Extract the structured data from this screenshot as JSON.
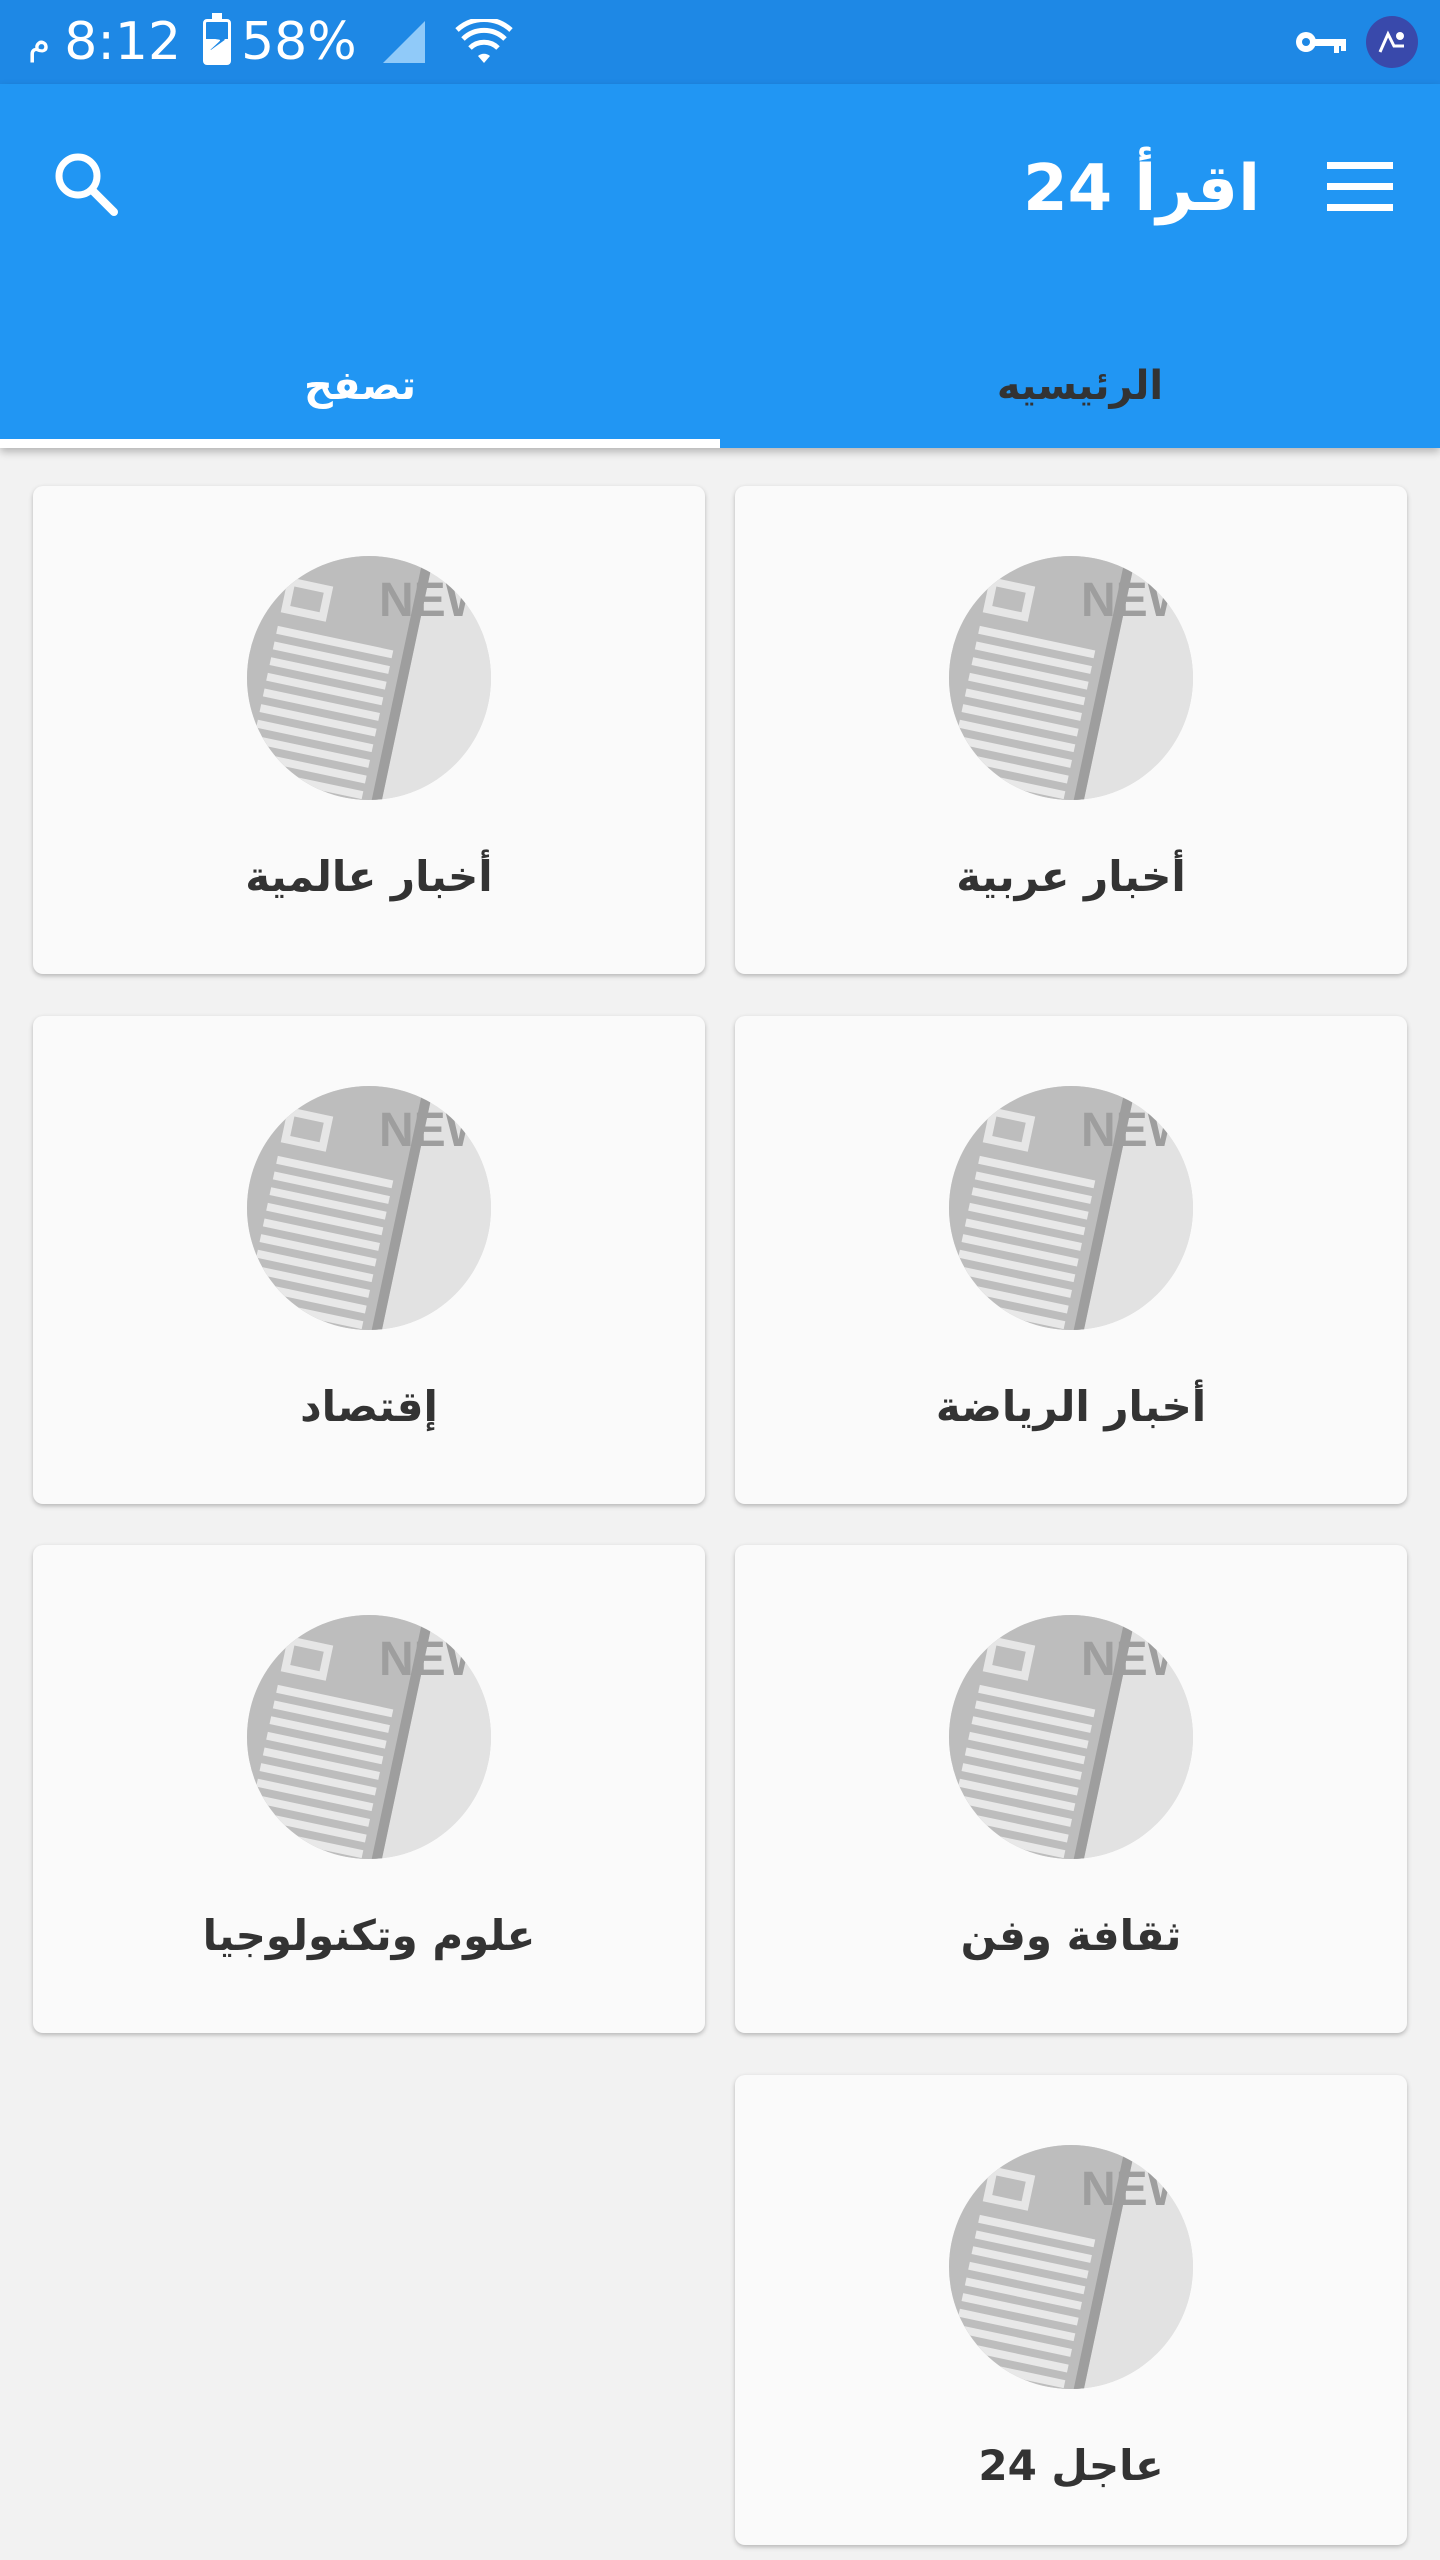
{
  "status_bar": {
    "time": "8:12",
    "ampm": "م",
    "battery": "58%",
    "icons": [
      "battery-charging-icon",
      "signal-icon",
      "wifi-icon",
      "vpn-key-icon",
      "notification-avatar-icon"
    ]
  },
  "app_bar": {
    "title": "اقرأ 24",
    "search_icon": "search-icon",
    "menu_icon": "menu-icon",
    "color": "#2196f3",
    "status_color": "#1e88e5"
  },
  "tabs": [
    {
      "label": "الرئيسيه",
      "active": false
    },
    {
      "label": "تصفح",
      "active": true
    }
  ],
  "categories": [
    {
      "label": "أخبار عربية",
      "thumb": "news-thumbnail"
    },
    {
      "label": "أخبار عالمية",
      "thumb": "news-thumbnail"
    },
    {
      "label": "أخبار الرياضة",
      "thumb": "news-thumbnail"
    },
    {
      "label": "إقتصاد",
      "thumb": "news-thumbnail"
    },
    {
      "label": "ثقافة وفن",
      "thumb": "news-thumbnail"
    },
    {
      "label": "علوم وتكنولوجيا",
      "thumb": "news-thumbnail"
    },
    {
      "label": "عاجل 24",
      "thumb": "news-thumbnail"
    }
  ],
  "thumbnail_text": "NEW"
}
